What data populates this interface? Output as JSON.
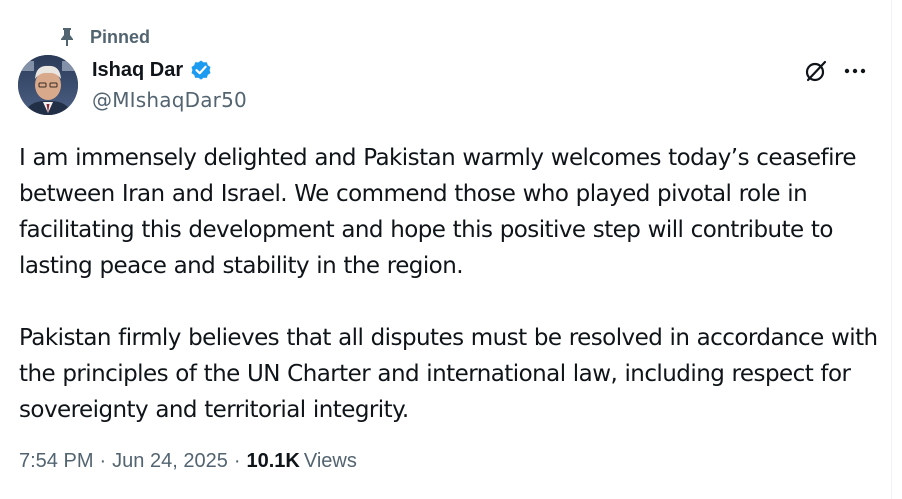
{
  "pinned_label": "Pinned",
  "author": {
    "name": "Ishaq Dar",
    "handle": "@MIshaqDar50",
    "verified": true
  },
  "tweet": {
    "paragraphs": [
      "I am immensely delighted and Pakistan warmly welcomes today’s ceasefire between Iran and Israel. We commend those who played pivotal role in facilitating this development and hope this positive step will contribute to lasting peace and stability in the region.",
      "Pakistan firmly believes that all disputes must be resolved in accordance with the principles of the UN Charter and international law, including respect for sovereignty and territorial integrity."
    ]
  },
  "meta": {
    "time": "7:54 PM",
    "separator": "·",
    "date": "Jun 24, 2025",
    "views_count": "10.1K",
    "views_label": "Views"
  },
  "colors": {
    "verified_blue": "#1d9bf0",
    "secondary_text": "#536471",
    "primary_text": "#0f1419"
  },
  "icons": {
    "pin": "pin-icon",
    "verified": "verified-badge-icon",
    "grok": "grok-icon",
    "more": "more-options-icon"
  }
}
